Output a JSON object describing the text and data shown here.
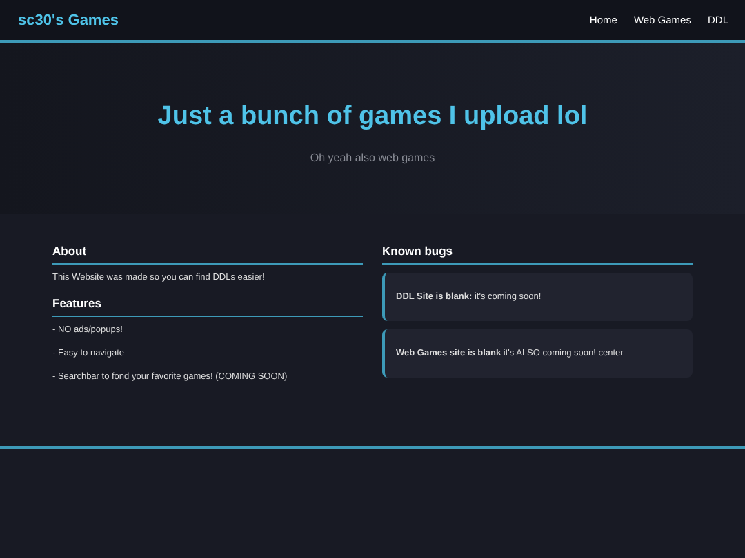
{
  "header": {
    "logo": "sc30's Games",
    "nav": [
      {
        "label": "Home"
      },
      {
        "label": "Web Games"
      },
      {
        "label": "DDL"
      }
    ]
  },
  "hero": {
    "title": "Just a bunch of games I upload lol",
    "subtitle": "Oh yeah also web games"
  },
  "left": [
    {
      "heading": "About",
      "paragraphs": [
        "This Website was made so you can find DDLs easier!"
      ]
    },
    {
      "heading": "Features",
      "paragraphs": [
        "- NO ads/popups!",
        "- Easy to navigate",
        "- Searchbar to fond your favorite games! (COMING SOON)"
      ]
    }
  ],
  "right": {
    "heading": "Known bugs",
    "bugs": [
      {
        "text": "**DDL Site is blank:** it's coming soon!"
      },
      {
        "text": "**Web Games site is blank** it's ALSO coming soon! center"
      }
    ]
  }
}
